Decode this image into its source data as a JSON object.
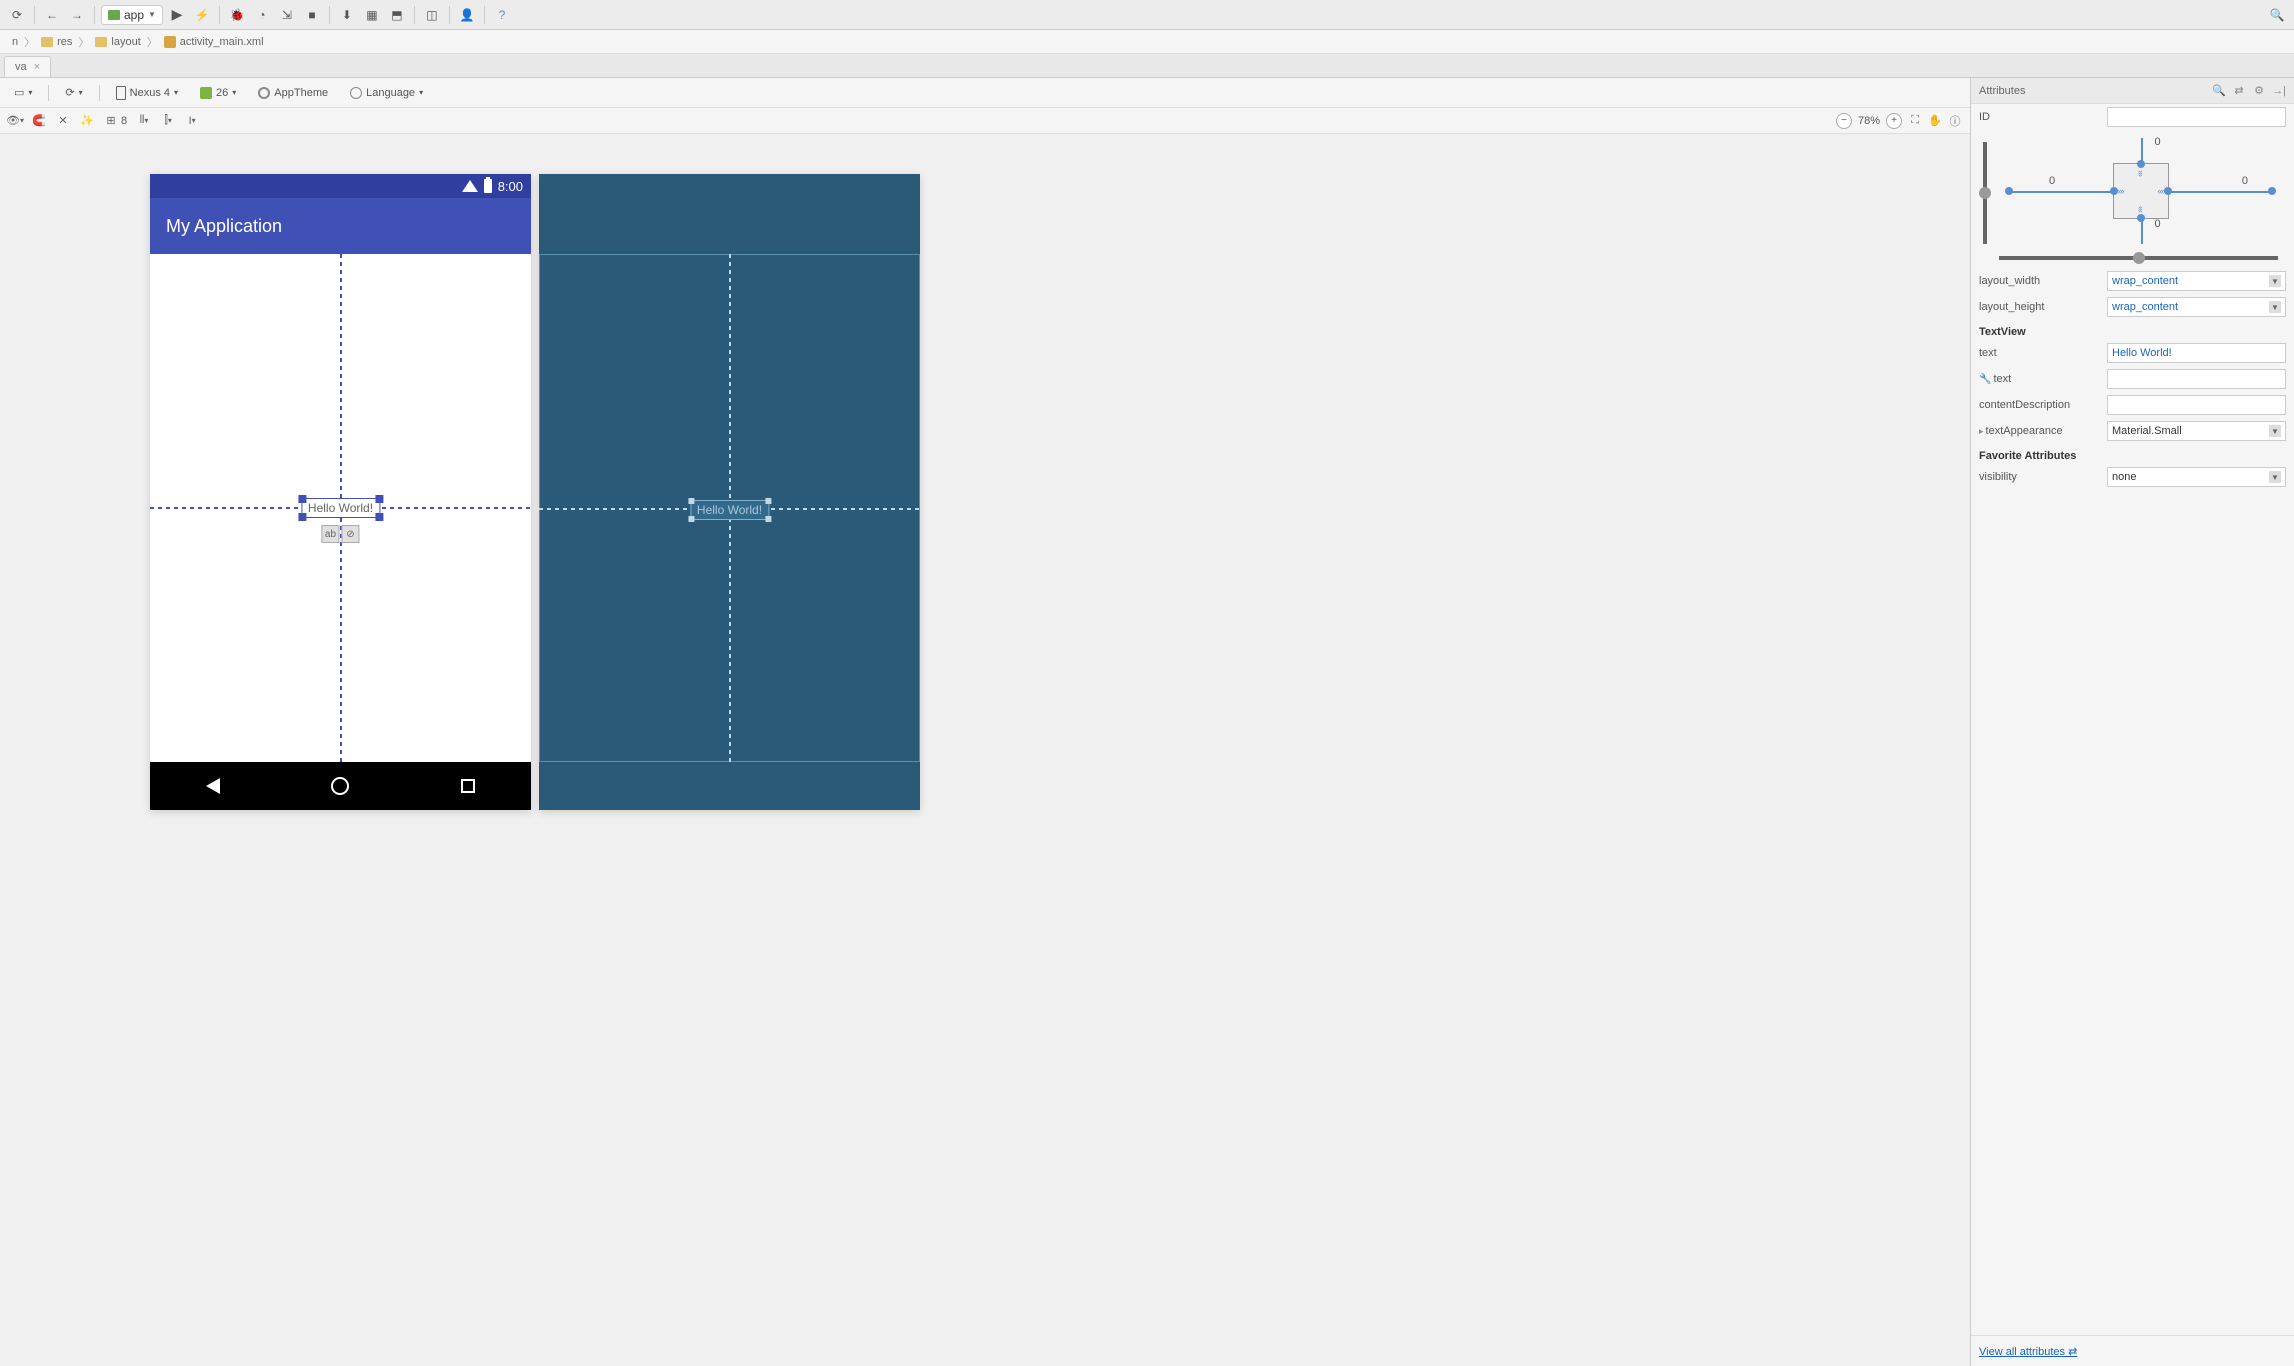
{
  "toolbar": {
    "app_dropdown": "app"
  },
  "breadcrumb": {
    "items": [
      "n",
      "res",
      "layout",
      "activity_main.xml"
    ]
  },
  "tabs": {
    "active": "va"
  },
  "design_toolbar": {
    "device": "Nexus 4",
    "api": "26",
    "theme": "AppTheme",
    "language": "Language"
  },
  "design_toolbar2": {
    "default_margin": "8",
    "zoom": "78%"
  },
  "preview": {
    "status_time": "8:00",
    "app_title": "My Application",
    "widget_text": "Hello World!"
  },
  "blueprint": {
    "widget_text": "Hello World!"
  },
  "attributes": {
    "header": "Attributes",
    "id_label": "ID",
    "id_value": "",
    "constraint": {
      "top": "0",
      "bottom": "0",
      "left": "0",
      "right": "0"
    },
    "layout_width_label": "layout_width",
    "layout_width_value": "wrap_content",
    "layout_height_label": "layout_height",
    "layout_height_value": "wrap_content",
    "section_textview": "TextView",
    "text_label": "text",
    "text_value": "Hello World!",
    "text_tool_label": "text",
    "text_tool_value": "",
    "content_desc_label": "contentDescription",
    "content_desc_value": "",
    "text_appearance_label": "textAppearance",
    "text_appearance_value": "Material.Small",
    "section_favorite": "Favorite Attributes",
    "visibility_label": "visibility",
    "visibility_value": "none",
    "view_all": "View all attributes"
  }
}
